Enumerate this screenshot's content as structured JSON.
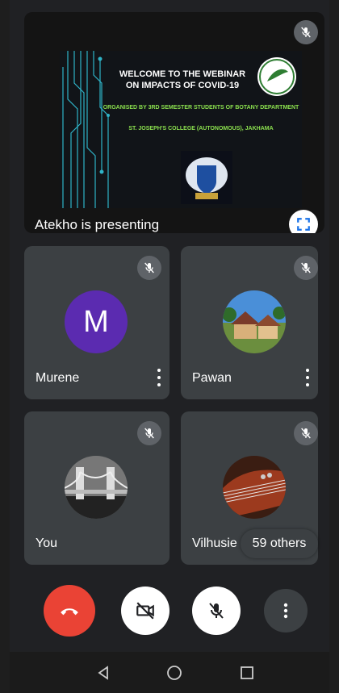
{
  "presentation": {
    "slide_title": "WELCOME TO THE WEBINAR ON IMPACTS OF COVID-19",
    "slide_org_line": "ORGANISED BY 3RD SEMESTER STUDENTS OF BOTANY DEPARTMENT",
    "slide_college_line": "ST. JOSEPH'S COLLEGE (AUTONOMOUS), JAKHAMA",
    "presenter_label": "Atekho is presenting"
  },
  "participants": [
    {
      "name": "Murene",
      "avatar_letter": "M",
      "avatar_color": "#5b2bb0"
    },
    {
      "name": "Pawan"
    },
    {
      "name": "You"
    },
    {
      "name": "Vilhusie"
    }
  ],
  "others_label": "59 others",
  "colors": {
    "background": "#202124",
    "tile": "#3c4043",
    "end_call": "#ea4335",
    "slide_green": "#8be04e"
  },
  "icons": {
    "mute": "mic-off-icon",
    "fullscreen": "fullscreen-icon",
    "end_call": "phone-hangup-icon",
    "camera": "video-off-icon",
    "mic": "mic-off-icon",
    "more": "more-vert-icon",
    "nav_back": "back-triangle-icon",
    "nav_home": "home-circle-icon",
    "nav_recents": "recents-square-icon"
  }
}
